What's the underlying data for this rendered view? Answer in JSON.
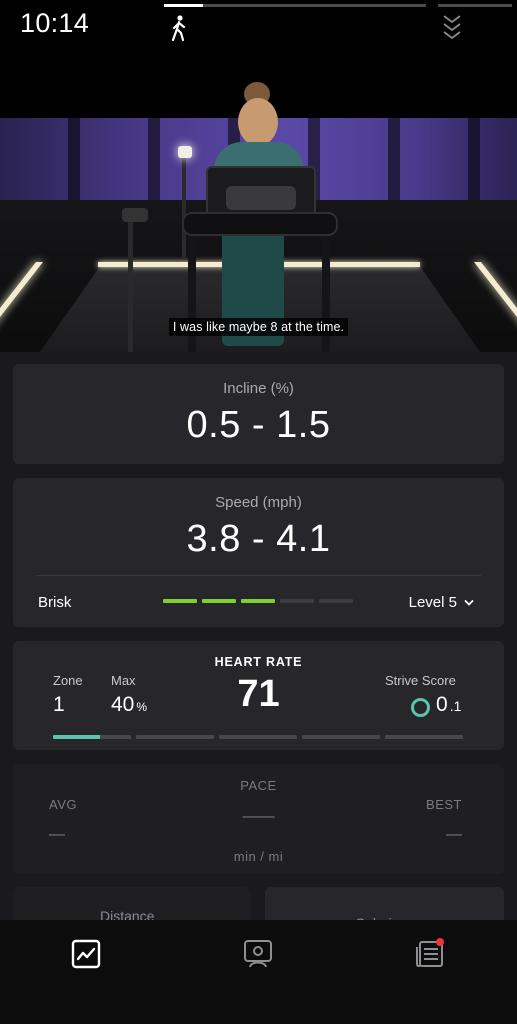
{
  "status": {
    "time": "10:14"
  },
  "video": {
    "progress": 0.15,
    "subtitle": "I was like maybe 8 at the time.",
    "icons": {
      "activity": "walking-person-icon",
      "collapse": "chevrons-down-icon"
    }
  },
  "incline": {
    "label": "Incline (%)",
    "value": "0.5 - 1.5"
  },
  "speed": {
    "label": "Speed (mph)",
    "value": "3.8 - 4.1",
    "pace_name": "Brisk",
    "level_label": "Level 5",
    "level_bars_total": 5,
    "level_bars_filled": 3
  },
  "heart_rate": {
    "title": "HEART RATE",
    "value": "71",
    "zone_label": "Zone",
    "zone_value": "1",
    "max_label": "Max",
    "max_value": "40",
    "max_unit": "%",
    "strive_label": "Strive Score",
    "strive_value": "0",
    "strive_decimal": ".1",
    "zone_progress": 0.6
  },
  "pace": {
    "title": "PACE",
    "avg_label": "AVG",
    "best_label": "BEST",
    "avg_value": "—",
    "current_value": "——",
    "best_value": "—",
    "unit": "min / mi"
  },
  "peek": {
    "distance_label": "Distance",
    "calories_label": "Calori"
  },
  "colors": {
    "accent_green": "#7fd22a",
    "accent_teal": "#5cc3ae",
    "notification": "#ef3340"
  },
  "nav": {
    "items": [
      "metrics-icon",
      "instructor-icon",
      "class-plan-icon"
    ]
  }
}
